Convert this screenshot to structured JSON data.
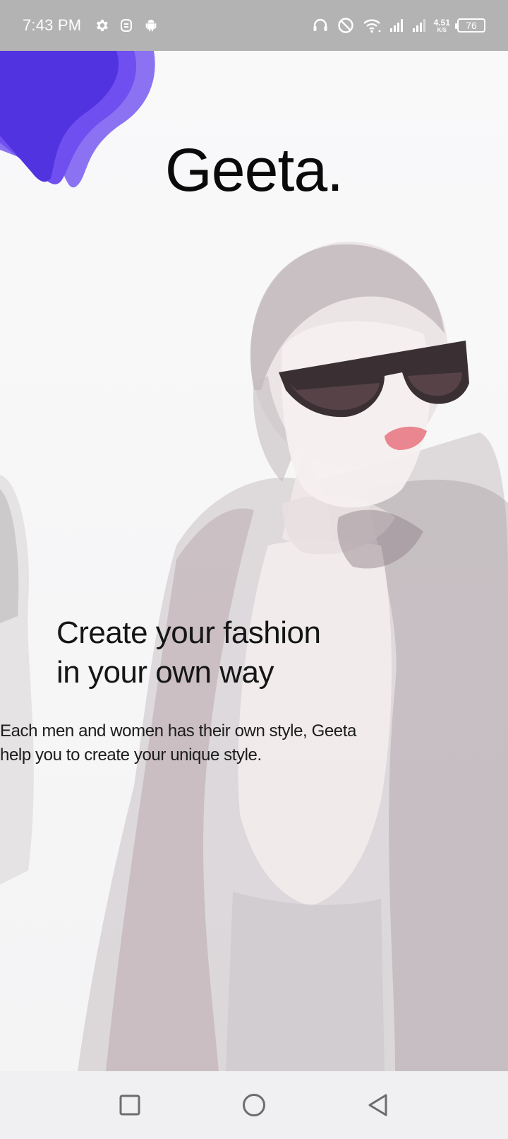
{
  "status_bar": {
    "time": "7:43 PM",
    "net_speed_value": "4.51",
    "net_speed_unit": "K/S",
    "battery_level": "76",
    "left_icons": [
      "settings-icon",
      "sim-toolkit-icon",
      "android-icon"
    ],
    "right_icons": [
      "headset-icon",
      "do-not-disturb-icon",
      "wifi-icon",
      "signal-icon",
      "signal-icon"
    ]
  },
  "brand": {
    "title": "Geeta.",
    "accent_colors": [
      "#5133e0",
      "#6f4ff0",
      "#8b72f3"
    ]
  },
  "onboarding": {
    "headline_line1": "Create your fashion",
    "headline_line2": "in your own way",
    "description_line1": "Each men and women has their own style, Geeta",
    "description_line2": "help you to create your unique style."
  },
  "nav_bar": {
    "buttons": [
      "recent-apps-icon",
      "home-icon",
      "back-icon"
    ]
  }
}
